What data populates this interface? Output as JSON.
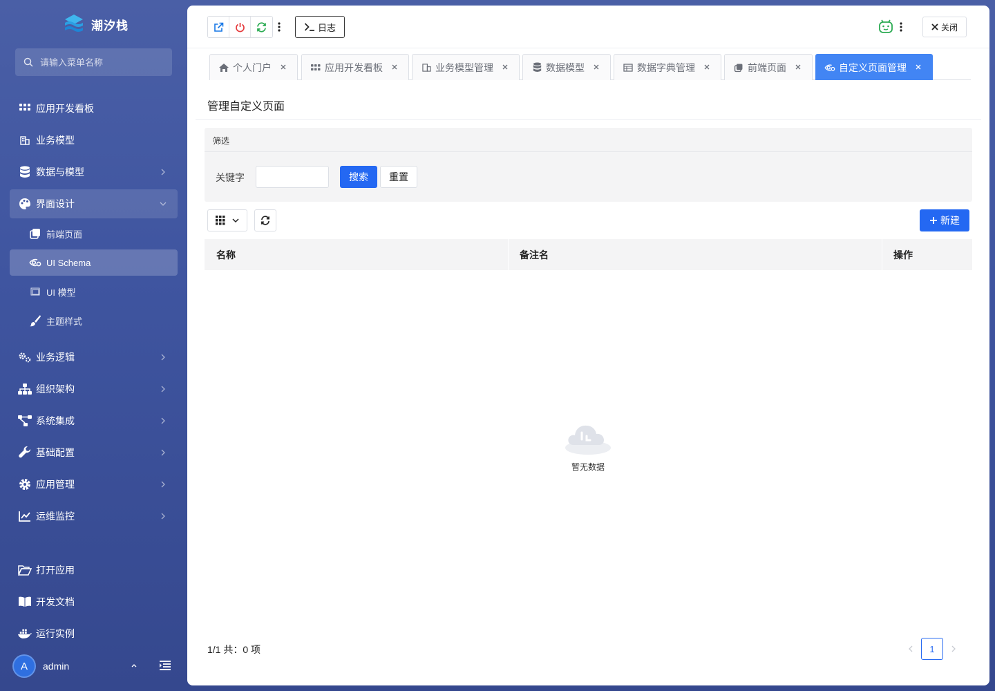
{
  "app": {
    "name": "潮汐栈"
  },
  "sidebar": {
    "search_placeholder": "请输入菜单名称",
    "items": [
      {
        "label": "应用开发看板",
        "icon": "grid-icon"
      },
      {
        "label": "业务模型",
        "icon": "building-icon"
      },
      {
        "label": "数据与模型",
        "icon": "database-icon"
      },
      {
        "label": "界面设计",
        "icon": "palette-icon"
      },
      {
        "label": "业务逻辑",
        "icon": "cogs-icon"
      },
      {
        "label": "组织架构",
        "icon": "sitemap-icon"
      },
      {
        "label": "系统集成",
        "icon": "project-diagram-icon"
      },
      {
        "label": "基础配置",
        "icon": "wrench-icon"
      },
      {
        "label": "应用管理",
        "icon": "gear-icon"
      },
      {
        "label": "运维监控",
        "icon": "chart-line-icon"
      }
    ],
    "subitems": [
      {
        "label": "前端页面",
        "icon": "clone-icon"
      },
      {
        "label": "UI Schema",
        "icon": "eye-gear-icon"
      },
      {
        "label": "UI 模型",
        "icon": "window-icon"
      },
      {
        "label": "主题样式",
        "icon": "brush-icon"
      }
    ],
    "bottom": [
      {
        "label": "打开应用",
        "icon": "folder-open-icon"
      },
      {
        "label": "开发文档",
        "icon": "book-icon"
      },
      {
        "label": "运行实例",
        "icon": "docker-icon"
      }
    ],
    "user": {
      "initial": "A",
      "name": "admin"
    }
  },
  "toolbar": {
    "log_label": "日志",
    "close_label": "关闭"
  },
  "tabs": [
    {
      "label": "个人门户",
      "icon": "home-icon"
    },
    {
      "label": "应用开发看板",
      "icon": "grid-icon"
    },
    {
      "label": "业务模型管理",
      "icon": "building-icon"
    },
    {
      "label": "数据模型",
      "icon": "database-icon"
    },
    {
      "label": "数据字典管理",
      "icon": "table-icon"
    },
    {
      "label": "前端页面",
      "icon": "clone-icon"
    },
    {
      "label": "自定义页面管理",
      "icon": "eye-gear-icon"
    }
  ],
  "page": {
    "title": "管理自定义页面",
    "filter": {
      "header": "筛选",
      "keyword_label": "关键字",
      "keyword_value": "",
      "search_label": "搜索",
      "reset_label": "重置"
    },
    "new_label": "新建",
    "columns": [
      "名称",
      "备注名",
      "操作"
    ],
    "rows": [],
    "empty_text": "暂无数据",
    "pagination": {
      "summary": "1/1 共：0 项",
      "current_page": "1"
    }
  },
  "colors": {
    "primary": "#2468f2",
    "tab_active": "#4285f4",
    "sidebar": "#3f55a0",
    "danger": "#e5393b",
    "success": "#2bab52"
  }
}
